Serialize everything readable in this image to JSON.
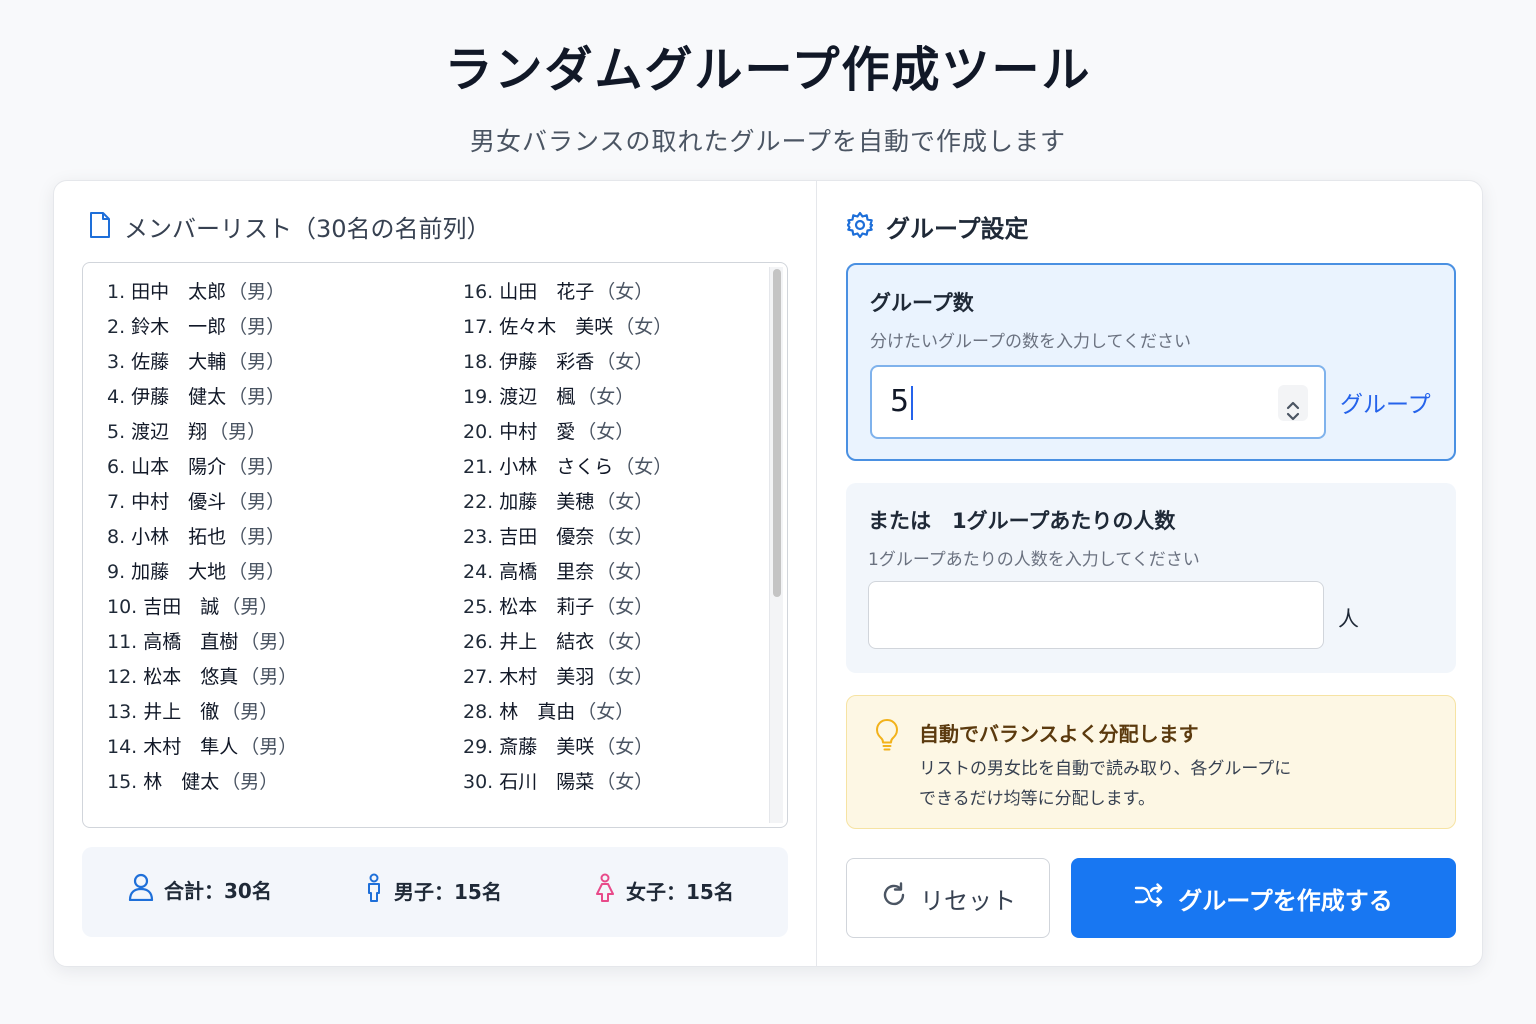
{
  "header": {
    "title": "ランダムグループ作成ツール",
    "subtitle": "男女バランスの取れたグループを自動で作成します"
  },
  "member_list": {
    "heading": "メンバーリスト（30名の名前列）",
    "icon": "document-icon",
    "members": [
      {
        "num": "1.",
        "name": "田中　太郎",
        "gender": "（男）"
      },
      {
        "num": "2.",
        "name": "鈴木　一郎",
        "gender": "（男）"
      },
      {
        "num": "3.",
        "name": "佐藤　大輔",
        "gender": "（男）"
      },
      {
        "num": "4.",
        "name": "伊藤　健太",
        "gender": "（男）"
      },
      {
        "num": "5.",
        "name": "渡辺　翔",
        "gender": "（男）"
      },
      {
        "num": "6.",
        "name": "山本　陽介",
        "gender": "（男）"
      },
      {
        "num": "7.",
        "name": "中村　優斗",
        "gender": "（男）"
      },
      {
        "num": "8.",
        "name": "小林　拓也",
        "gender": "（男）"
      },
      {
        "num": "9.",
        "name": "加藤　大地",
        "gender": "（男）"
      },
      {
        "num": "10.",
        "name": "吉田　誠",
        "gender": "（男）"
      },
      {
        "num": "11.",
        "name": "高橋　直樹",
        "gender": "（男）"
      },
      {
        "num": "12.",
        "name": "松本　悠真",
        "gender": "（男）"
      },
      {
        "num": "13.",
        "name": "井上　徹",
        "gender": "（男）"
      },
      {
        "num": "14.",
        "name": "木村　隼人",
        "gender": "（男）"
      },
      {
        "num": "15.",
        "name": "林　健太",
        "gender": "（男）"
      },
      {
        "num": "16.",
        "name": "山田　花子",
        "gender": "（女）"
      },
      {
        "num": "17.",
        "name": "佐々木　美咲",
        "gender": "（女）"
      },
      {
        "num": "18.",
        "name": "伊藤　彩香",
        "gender": "（女）"
      },
      {
        "num": "19.",
        "name": "渡辺　楓",
        "gender": "（女）"
      },
      {
        "num": "20.",
        "name": "中村　愛",
        "gender": "（女）"
      },
      {
        "num": "21.",
        "name": "小林　さくら",
        "gender": "（女）"
      },
      {
        "num": "22.",
        "name": "加藤　美穂",
        "gender": "（女）"
      },
      {
        "num": "23.",
        "name": "吉田　優奈",
        "gender": "（女）"
      },
      {
        "num": "24.",
        "name": "高橋　里奈",
        "gender": "（女）"
      },
      {
        "num": "25.",
        "name": "松本　莉子",
        "gender": "（女）"
      },
      {
        "num": "26.",
        "name": "井上　結衣",
        "gender": "（女）"
      },
      {
        "num": "27.",
        "name": "木村　美羽",
        "gender": "（女）"
      },
      {
        "num": "28.",
        "name": "林　真由",
        "gender": "（女）"
      },
      {
        "num": "29.",
        "name": "斎藤　美咲",
        "gender": "（女）"
      },
      {
        "num": "30.",
        "name": "石川　陽菜",
        "gender": "（女）"
      }
    ]
  },
  "stats": {
    "total": "合計：30名",
    "male": "男子：15名",
    "female": "女子：15名"
  },
  "settings": {
    "heading": "グループ設定",
    "group_count": {
      "title": "グループ数",
      "description": "分けたいグループの数を入力してください",
      "value": "5",
      "unit": "グループ"
    },
    "per_group": {
      "title": "または　1グループあたりの人数",
      "description": "1グループあたりの人数を入力してください",
      "value": "",
      "unit": "人"
    },
    "tip": {
      "title": "自動でバランスよく分配します",
      "line1": "リストの男女比を自動で読み取り、各グループに",
      "line2": "できるだけ均等に分配します。"
    }
  },
  "buttons": {
    "reset": "リセット",
    "create": "グループを作成する"
  },
  "colors": {
    "primary": "#1877f2",
    "accent_border": "#4a90e2",
    "tip_bg": "#fdf7e4",
    "male_icon": "#1e6fd9",
    "female_icon": "#e84a8a"
  }
}
